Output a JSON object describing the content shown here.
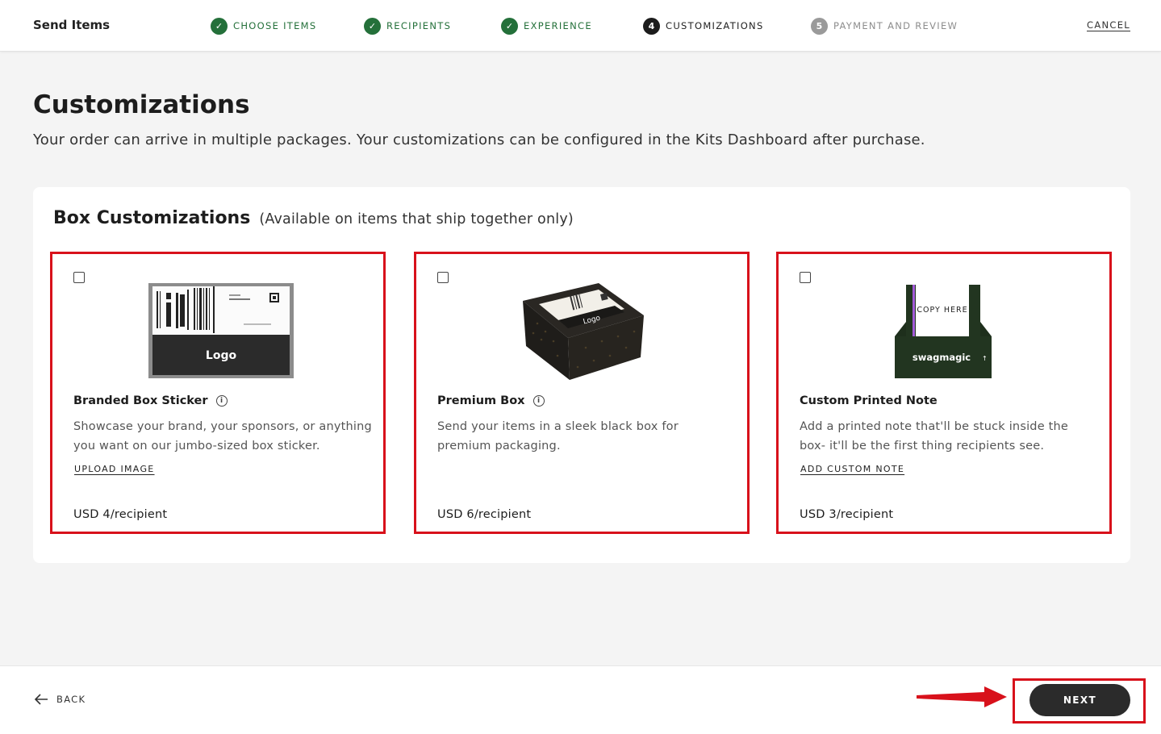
{
  "header": {
    "title": "Send Items",
    "steps": [
      {
        "label": "CHOOSE ITEMS",
        "state": "done",
        "marker": "✓"
      },
      {
        "label": "RECIPIENTS",
        "state": "done",
        "marker": "✓"
      },
      {
        "label": "EXPERIENCE",
        "state": "done",
        "marker": "✓"
      },
      {
        "label": "CUSTOMIZATIONS",
        "state": "current",
        "marker": "4"
      },
      {
        "label": "PAYMENT AND REVIEW",
        "state": "todo",
        "marker": "5"
      }
    ],
    "cancel_label": "CANCEL"
  },
  "page": {
    "title": "Customizations",
    "subtitle": "Your order can arrive in multiple packages. Your customizations can be configured in the Kits Dashboard after purchase."
  },
  "box_customizations": {
    "title": "Box Customizations",
    "note": "(Available on items that ship together only)",
    "cards": [
      {
        "name": "Branded Box Sticker",
        "description": "Showcase your brand, your sponsors, or anything you want on our jumbo-sized box sticker.",
        "link": "UPLOAD IMAGE",
        "price": "USD 4/recipient",
        "image_text": "Logo",
        "info_icon": true
      },
      {
        "name": "Premium Box",
        "description": "Send your items in a sleek black box for premium packaging.",
        "link": "",
        "price": "USD 6/recipient",
        "image_text": "Logo",
        "info_icon": true
      },
      {
        "name": "Custom Printed Note",
        "description": "Add a printed note that'll be stuck inside the box- it'll be the first thing recipients see.",
        "link": "ADD CUSTOM NOTE",
        "price": "USD 3/recipient",
        "image_text": "COPY HERE",
        "image_brand": "swagmagic",
        "info_icon": false
      }
    ]
  },
  "footer": {
    "back_label": "BACK",
    "next_label": "NEXT"
  },
  "colors": {
    "step_done": "#24703a",
    "highlight": "#d8111b",
    "primary_button": "#2b2b2b"
  }
}
